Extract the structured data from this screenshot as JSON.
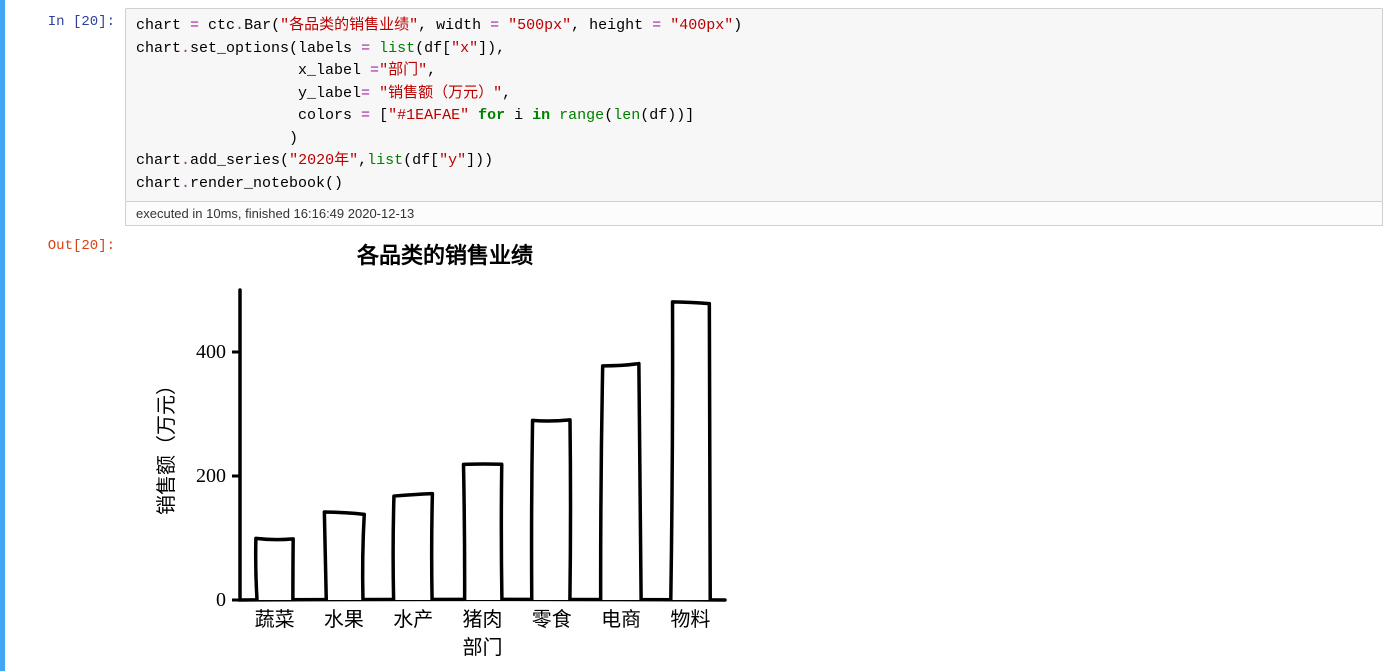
{
  "cell": {
    "in_prompt": "In [20]:",
    "out_prompt": "Out[20]:",
    "exec_time": "executed in 10ms, finished 16:16:49 2020-12-13",
    "code": {
      "l1a": "chart ",
      "l1_eq": "=",
      "l1b": " ctc",
      "l1_dot1": ".",
      "l1c": "Bar(",
      "l1_str1": "\"各品类的销售业绩\"",
      "l1d": ", width ",
      "l1_eq2": "=",
      "l1e": " ",
      "l1_str2": "\"500px\"",
      "l1f": ", height ",
      "l1_eq3": "=",
      "l1g": " ",
      "l1_str3": "\"400px\"",
      "l1h": ")",
      "l2a": "chart",
      "l2_dot": ".",
      "l2b": "set_options(labels ",
      "l2_eq": "=",
      "l2c": " ",
      "l2_list": "list",
      "l2d": "(df[",
      "l2_str": "\"x\"",
      "l2e": "]),",
      "l3a": "                  x_label ",
      "l3_eq": "=",
      "l3_str": "\"部门\"",
      "l3b": ",",
      "l4a": "                  y_label",
      "l4_eq": "=",
      "l4b": " ",
      "l4_str": "\"销售额（万元）\"",
      "l4c": ",",
      "l5a": "                  colors ",
      "l5_eq": "=",
      "l5b": " [",
      "l5_str": "\"#1EAFAE\"",
      "l5c": " ",
      "l5_for": "for",
      "l5d": " i ",
      "l5_in": "in",
      "l5e": " ",
      "l5_range": "range",
      "l5f": "(",
      "l5_len": "len",
      "l5g": "(df))]",
      "l6": "                 )",
      "l7a": "chart",
      "l7_dot": ".",
      "l7b": "add_series(",
      "l7_str": "\"2020年\"",
      "l7c": ",",
      "l7_list": "list",
      "l7d": "(df[",
      "l7_str2": "\"y\"",
      "l7e": "]))",
      "l8a": "chart",
      "l8_dot": ".",
      "l8b": "render_notebook()"
    }
  },
  "chart_data": {
    "type": "bar",
    "title": "各品类的销售业绩",
    "xlabel": "部门",
    "ylabel": "销售额（万元）",
    "categories": [
      "蔬菜",
      "水果",
      "水产",
      "猪肉",
      "零食",
      "电商",
      "物料"
    ],
    "values": [
      100,
      140,
      170,
      220,
      290,
      380,
      480
    ],
    "yticks": [
      0,
      200,
      400
    ],
    "ylim": [
      0,
      500
    ],
    "bar_color": "#1EAFAE",
    "series_name": "2020年"
  }
}
